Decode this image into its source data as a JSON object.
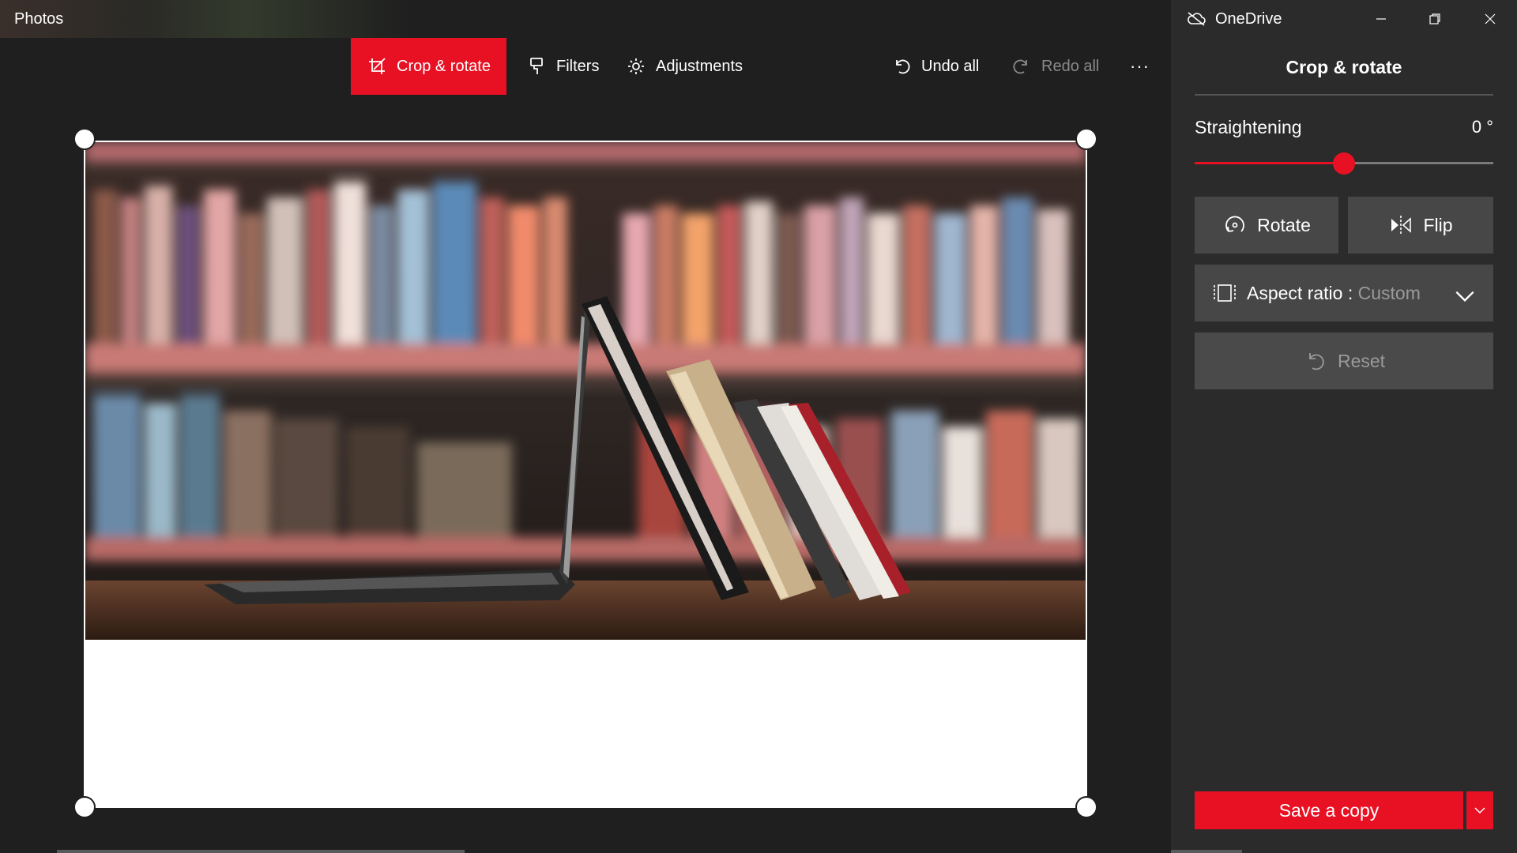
{
  "app": {
    "title": "Photos"
  },
  "toolbar": {
    "crop_rotate": "Crop & rotate",
    "filters": "Filters",
    "adjustments": "Adjustments",
    "undo_all": "Undo all",
    "redo_all": "Redo all",
    "more": "···"
  },
  "onedrive": {
    "label": "OneDrive"
  },
  "panel": {
    "title": "Crop & rotate",
    "straightening_label": "Straightening",
    "straightening_value": "0 °",
    "straightening_level": 0.5,
    "rotate": "Rotate",
    "flip": "Flip",
    "aspect_label": "Aspect ratio : ",
    "aspect_value": "Custom",
    "reset": "Reset",
    "save": "Save a copy"
  },
  "colors": {
    "accent": "#e81123",
    "panel_bg": "#2b2b2b",
    "app_bg": "#1f1f1f",
    "button_bg": "#474747"
  }
}
